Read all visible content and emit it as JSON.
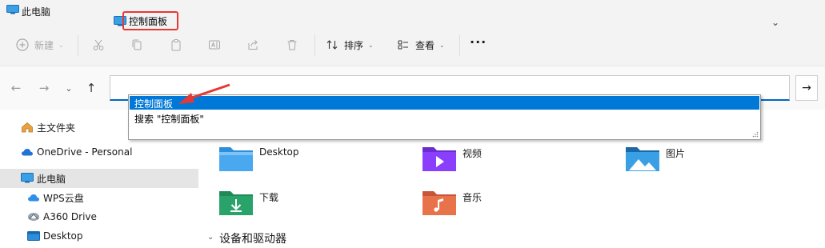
{
  "window": {
    "title": "此电脑"
  },
  "toolbar": {
    "new_label": "新建",
    "sort_label": "排序",
    "view_label": "查看",
    "more_label": "···"
  },
  "address": {
    "value": "控制面板"
  },
  "suggestions": [
    {
      "label": "控制面板"
    },
    {
      "label": "搜索 \"控制面板\""
    }
  ],
  "sidebar": {
    "items": [
      {
        "label": "主文件夹"
      },
      {
        "label": "OneDrive - Personal"
      },
      {
        "label": "此电脑"
      },
      {
        "label": "WPS云盘"
      },
      {
        "label": "A360 Drive"
      },
      {
        "label": "Desktop"
      }
    ]
  },
  "folders": [
    {
      "label": "Desktop"
    },
    {
      "label": "视频"
    },
    {
      "label": "图片"
    },
    {
      "label": "下载"
    },
    {
      "label": "音乐"
    }
  ],
  "sections": {
    "devices_label": "设备和驱动器"
  },
  "colors": {
    "accent": "#0078d7",
    "annotation_red": "#e53935",
    "folder_blue": "#2d8fdb",
    "folder_green": "#2aa36b",
    "folder_purple": "#8a3ffc",
    "folder_orange": "#e8734a"
  }
}
